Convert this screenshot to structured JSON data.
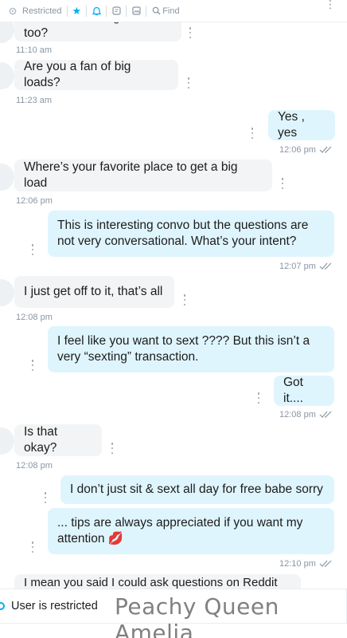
{
  "toolbar": {
    "restricted_label": "Restricted",
    "find_label": "Find",
    "icons": [
      "restricted-icon",
      "star-icon",
      "bell-icon",
      "tip-icon",
      "media-icon",
      "search-icon",
      "more-icon"
    ],
    "accent": "#00aff0"
  },
  "messages": [
    {
      "id": "m1",
      "dir": "in",
      "text": "Did he have a big load too?",
      "time": "11:10 am"
    },
    {
      "id": "m2",
      "dir": "in",
      "text": "Are you a fan of big loads?",
      "time": "11:23 am"
    },
    {
      "id": "m3",
      "dir": "out",
      "text": "Yes , yes",
      "time": "12:06 pm"
    },
    {
      "id": "m4",
      "dir": "in",
      "text": "Where’s your favorite place to get a big load",
      "time": "12:06 pm"
    },
    {
      "id": "m5",
      "dir": "out",
      "line1": "This is interesting convo but the questions are",
      "line2": "not very conversational. What’s your intent?",
      "time": "12:07 pm"
    },
    {
      "id": "m6",
      "dir": "in",
      "text": "I just get off to it, that’s all",
      "time": "12:08 pm"
    },
    {
      "id": "m7",
      "dir": "out",
      "line1": "I feel like you want to sext ???? But this isn’t a",
      "line2": "very “sexting” transaction."
    },
    {
      "id": "m8",
      "dir": "out",
      "text": "Got it....",
      "time": "12:08 pm"
    },
    {
      "id": "m9",
      "dir": "in",
      "text": "Is that okay?",
      "time": "12:08 pm"
    },
    {
      "id": "m10",
      "dir": "out",
      "text": "I don’t just sit & sext all day for free babe sorry"
    },
    {
      "id": "m11",
      "dir": "out",
      "line1": "... tips are always appreciated if you want my",
      "line2": "attention 💋",
      "time": "12:10 pm"
    },
    {
      "id": "m12",
      "dir": "in",
      "text": "I mean you said I could ask questions on Reddit"
    }
  ],
  "footer": {
    "status": "User is restricted",
    "watermark": "Peachy Queen Amelia"
  },
  "colors": {
    "incoming_bubble": "#f2f4f5",
    "outgoing_bubble": "#dff5fd",
    "time_text": "#8a96a3"
  }
}
